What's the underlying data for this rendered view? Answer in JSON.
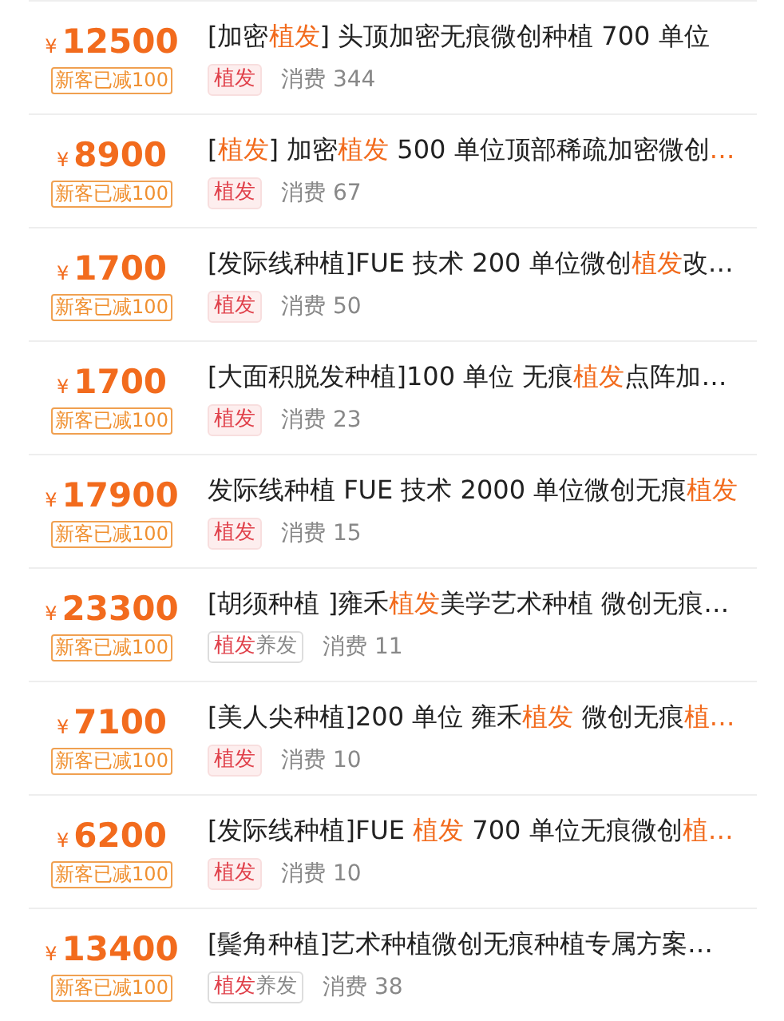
{
  "items": [
    {
      "currency": "¥",
      "price": "12500",
      "discount": "新客已减100",
      "title": [
        {
          "text": "[加密",
          "highlight": false
        },
        {
          "text": "植发",
          "highlight": true
        },
        {
          "text": "] 头顶加密无痕微创种植 700 单位",
          "highlight": false
        }
      ],
      "tag": {
        "kind": "single",
        "parts": [
          {
            "text": "植发",
            "highlight": true
          }
        ]
      },
      "sales": "消费 344"
    },
    {
      "currency": "¥",
      "price": "8900",
      "discount": "新客已减100",
      "title": [
        {
          "text": "[",
          "highlight": false
        },
        {
          "text": "植发",
          "highlight": true
        },
        {
          "text": "] 加密",
          "highlight": false
        },
        {
          "text": "植发",
          "highlight": true
        },
        {
          "text": " 500 单位顶部稀疏加密微创",
          "highlight": false
        },
        {
          "text": "…",
          "highlight": true
        }
      ],
      "tag": {
        "kind": "single",
        "parts": [
          {
            "text": "植发",
            "highlight": true
          }
        ]
      },
      "sales": "消费 67"
    },
    {
      "currency": "¥",
      "price": "1700",
      "discount": "新客已减100",
      "title": [
        {
          "text": "[发际线种植]FUE 技术 200 单位微创",
          "highlight": false
        },
        {
          "text": "植发",
          "highlight": true
        },
        {
          "text": "改…",
          "highlight": false
        }
      ],
      "tag": {
        "kind": "single",
        "parts": [
          {
            "text": "植发",
            "highlight": true
          }
        ]
      },
      "sales": "消费 50"
    },
    {
      "currency": "¥",
      "price": "1700",
      "discount": "新客已减100",
      "title": [
        {
          "text": "[大面积脱发种植]100 单位 无痕",
          "highlight": false
        },
        {
          "text": "植发",
          "highlight": true
        },
        {
          "text": "点阵加…",
          "highlight": false
        }
      ],
      "tag": {
        "kind": "single",
        "parts": [
          {
            "text": "植发",
            "highlight": true
          }
        ]
      },
      "sales": "消费 23"
    },
    {
      "currency": "¥",
      "price": "17900",
      "discount": "新客已减100",
      "title": [
        {
          "text": "发际线种植 FUE 技术 2000 单位微创无痕",
          "highlight": false
        },
        {
          "text": "植发",
          "highlight": true
        }
      ],
      "tag": {
        "kind": "single",
        "parts": [
          {
            "text": "植发",
            "highlight": true
          }
        ]
      },
      "sales": "消费 15"
    },
    {
      "currency": "¥",
      "price": "23300",
      "discount": "新客已减100",
      "title": [
        {
          "text": "[胡须种植 ]雍禾",
          "highlight": false
        },
        {
          "text": "植发",
          "highlight": true
        },
        {
          "text": "美学艺术种植 微创无痕…",
          "highlight": false
        }
      ],
      "tag": {
        "kind": "combo",
        "parts": [
          {
            "text": "植发",
            "highlight": true
          },
          {
            "text": "养发",
            "highlight": false
          }
        ]
      },
      "sales": "消费 11"
    },
    {
      "currency": "¥",
      "price": "7100",
      "discount": "新客已减100",
      "title": [
        {
          "text": "[美人尖种植]200 单位 雍禾",
          "highlight": false
        },
        {
          "text": "植发",
          "highlight": true
        },
        {
          "text": " 微创无痕",
          "highlight": false
        },
        {
          "text": "植…",
          "highlight": true
        }
      ],
      "tag": {
        "kind": "single",
        "parts": [
          {
            "text": "植发",
            "highlight": true
          }
        ]
      },
      "sales": "消费 10"
    },
    {
      "currency": "¥",
      "price": "6200",
      "discount": "新客已减100",
      "title": [
        {
          "text": "[发际线种植]FUE ",
          "highlight": false
        },
        {
          "text": "植发",
          "highlight": true
        },
        {
          "text": " 700 单位无痕微创",
          "highlight": false
        },
        {
          "text": "植…",
          "highlight": true
        }
      ],
      "tag": {
        "kind": "single",
        "parts": [
          {
            "text": "植发",
            "highlight": true
          }
        ]
      },
      "sales": "消费 10"
    },
    {
      "currency": "¥",
      "price": "13400",
      "discount": "新客已减100",
      "title": [
        {
          "text": "[鬓角种植]艺术种植微创无痕种植专属方案…",
          "highlight": false
        }
      ],
      "tag": {
        "kind": "combo",
        "parts": [
          {
            "text": "植发",
            "highlight": true
          },
          {
            "text": "养发",
            "highlight": false
          }
        ]
      },
      "sales": "消费 38"
    }
  ]
}
